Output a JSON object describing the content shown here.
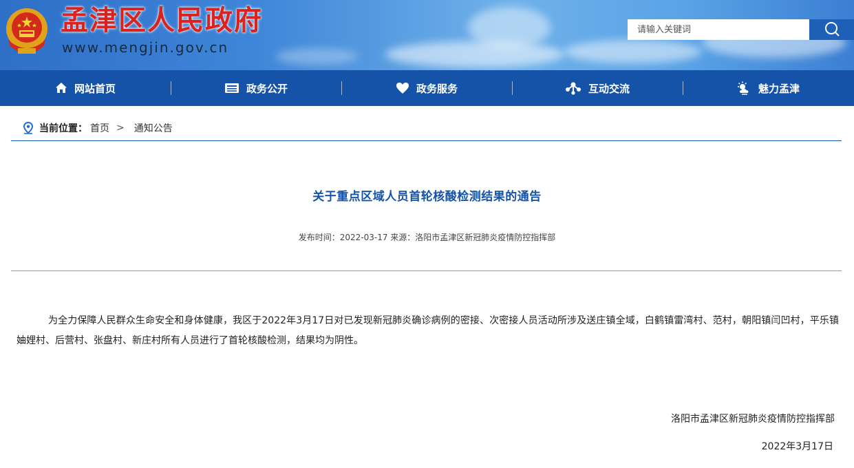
{
  "header": {
    "site_name": "孟津区人民政府",
    "site_url": "www.mengjin.gov.cn",
    "search_placeholder": "请输入关键词"
  },
  "nav": {
    "items": [
      {
        "label": "网站首页",
        "icon": "home-icon"
      },
      {
        "label": "政务公开",
        "icon": "newspaper-icon"
      },
      {
        "label": "政务服务",
        "icon": "heart-icon"
      },
      {
        "label": "互动交流",
        "icon": "share-network-icon"
      },
      {
        "label": "魅力孟津",
        "icon": "weather-sun-cloud-icon"
      }
    ]
  },
  "breadcrumb": {
    "label": "当前位置：",
    "home": "首页",
    "separator": ">",
    "current": "通知公告"
  },
  "article": {
    "title": "关于重点区域人员首轮核酸检测结果的通告",
    "meta": "发布时间：2022-03-17 来源：洛阳市孟津区新冠肺炎疫情防控指挥部",
    "body": "为全力保障人民群众生命安全和身体健康，我区于2022年3月17日对已发现新冠肺炎确诊病例的密接、次密接人员活动所涉及送庄镇全域，白鹤镇雷湾村、范村，朝阳镇闫凹村，平乐镇妯娌村、后营村、张盘村、新庄村所有人员进行了首轮核酸检测，结果均为阴性。",
    "signature_org": "洛阳市孟津区新冠肺炎疫情防控指挥部",
    "signature_date": "2022年3月17日"
  },
  "colors": {
    "nav_bg": "#1453a8",
    "title": "#1453a8",
    "site_name": "#d8231f"
  }
}
